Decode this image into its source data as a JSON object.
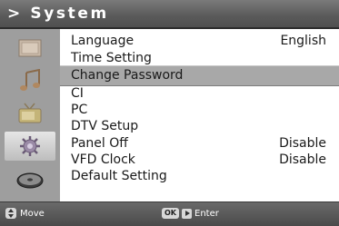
{
  "header": {
    "title": "> System"
  },
  "sidebar": {
    "icons": [
      {
        "name": "screen-icon"
      },
      {
        "name": "music-icon"
      },
      {
        "name": "tv-icon"
      },
      {
        "name": "system-icon",
        "active": true
      },
      {
        "name": "disc-icon"
      }
    ]
  },
  "menu": {
    "items": [
      {
        "label": "Language",
        "value": "English"
      },
      {
        "label": "Time Setting",
        "value": ""
      },
      {
        "label": "Change Password",
        "value": "",
        "selected": true
      },
      {
        "label": "CI",
        "value": ""
      },
      {
        "label": "PC",
        "value": ""
      },
      {
        "label": "DTV Setup",
        "value": ""
      },
      {
        "label": "Panel Off",
        "value": "Disable"
      },
      {
        "label": "VFD Clock",
        "value": "Disable"
      },
      {
        "label": "Default Setting",
        "value": ""
      }
    ]
  },
  "footer": {
    "move_label": "Move",
    "ok_key": "OK",
    "enter_label": "Enter"
  },
  "colors": {
    "title_bar": "#5a5a5a",
    "sidebar": "#9e9e9e",
    "highlight": "#a8a8a8",
    "text": "#1a1a1a"
  }
}
